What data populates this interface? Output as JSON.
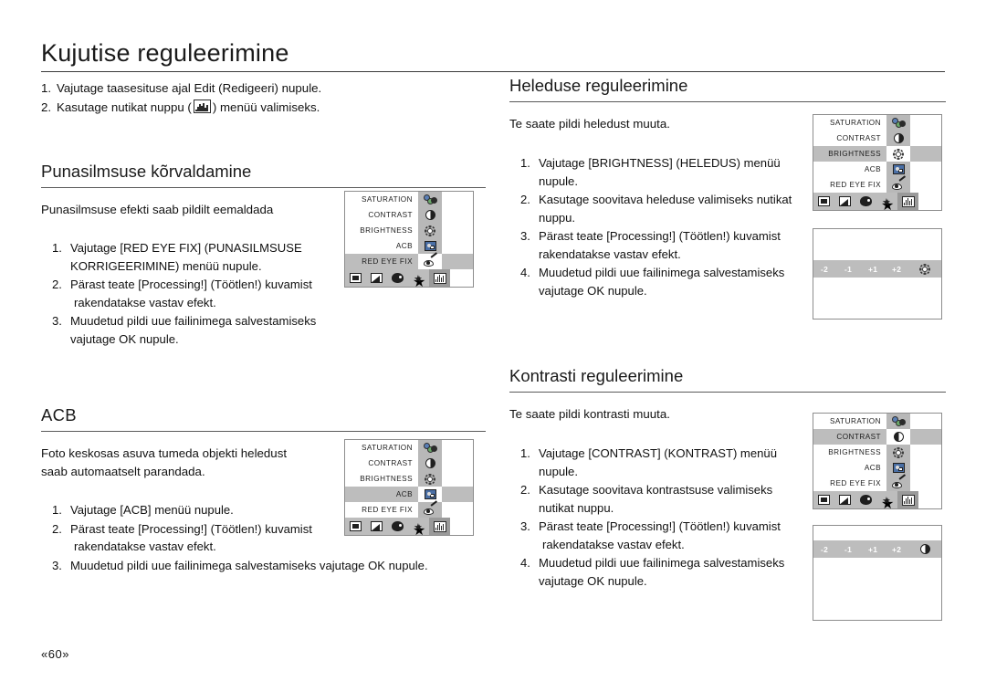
{
  "page": {
    "title": "Kujutise reguleerimine",
    "number": "«60»"
  },
  "intro": {
    "steps": [
      {
        "num": "1.",
        "pre": "Vajutage taasesituse ajal Edit (Redigeeri) nupule.",
        "post": ""
      },
      {
        "num": "2.",
        "pre": "Kasutage nutikat nuppu (",
        "post": ") menüü valimiseks.",
        "icon": "histogram-icon"
      }
    ]
  },
  "sections": {
    "red_eye": {
      "heading": "Punasilmsuse kõrvaldamine",
      "lead": "Punasilmsuse efekti saab pildilt eemaldada",
      "steps": [
        {
          "num": "1.",
          "lines": [
            "Vajutage [RED EYE FIX] (PUNASILMSUSE",
            "KORRIGEERIMINE) menüü nupule."
          ]
        },
        {
          "num": "2.",
          "lines": [
            "Pärast teate [Processing!] (Töötlen!) kuvamist",
            "rakendatakse vastav efekt."
          ]
        },
        {
          "num": "3.",
          "lines": [
            "Muudetud pildi uue failinimega salvestamiseks",
            "vajutage OK nupule."
          ]
        }
      ]
    },
    "acb": {
      "heading": "ACB",
      "lead_lines": [
        "Foto keskosas asuva tumeda objekti heledust",
        "saab automaatselt parandada."
      ],
      "steps": [
        {
          "num": "1.",
          "lines": [
            "Vajutage [ACB] menüü nupule."
          ]
        },
        {
          "num": "2.",
          "lines": [
            "Pärast teate [Processing!] (Töötlen!) kuvamist",
            "rakendatakse vastav efekt."
          ]
        },
        {
          "num": "3.",
          "lines": [
            "Muudetud pildi uue failinimega salvestamiseks vajutage OK nupule."
          ]
        }
      ]
    },
    "brightness": {
      "heading": "Heleduse reguleerimine",
      "lead": "Te saate pildi heledust muuta.",
      "steps": [
        {
          "num": "1.",
          "lines": [
            "Vajutage [BRIGHTNESS] (HELEDUS) menüü",
            "nupule."
          ]
        },
        {
          "num": "2.",
          "lines": [
            "Kasutage soovitava heleduse valimiseks nutikat",
            "nuppu."
          ]
        },
        {
          "num": "3.",
          "lines": [
            "Pärast teate [Processing!] (Töötlen!) kuvamist",
            "rakendatakse vastav efekt."
          ]
        },
        {
          "num": "4.",
          "lines": [
            "Muudetud pildi uue failinimega salvestamiseks",
            "vajutage OK nupule."
          ]
        }
      ]
    },
    "contrast": {
      "heading": "Kontrasti reguleerimine",
      "lead": "Te saate pildi kontrasti muuta.",
      "steps": [
        {
          "num": "1.",
          "lines": [
            "Vajutage [CONTRAST] (KONTRAST) menüü",
            "nupule."
          ]
        },
        {
          "num": "2.",
          "lines": [
            "Kasutage soovitava kontrastsuse valimiseks",
            "nutikat nuppu."
          ]
        },
        {
          "num": "3.",
          "lines": [
            "Pärast teate [Processing!] (Töötlen!) kuvamist",
            "rakendatakse vastav efekt."
          ]
        },
        {
          "num": "4.",
          "lines": [
            "Muudetud pildi uue failinimega salvestamiseks",
            "vajutage OK nupule."
          ]
        }
      ]
    }
  },
  "osd": {
    "menu_items": [
      "SATURATION",
      "CONTRAST",
      "BRIGHTNESS",
      "ACB",
      "RED EYE FIX"
    ],
    "tab_icons": [
      "image-icon",
      "resize-icon",
      "palette-icon",
      "star-effect-icon",
      "histogram-icon"
    ],
    "active_tab": "histogram-icon",
    "value_strip": [
      "-2",
      "-1",
      "+1",
      "+2"
    ],
    "panels": {
      "red_eye": {
        "selected": "RED EYE FIX"
      },
      "acb": {
        "selected": "ACB"
      },
      "brightness": {
        "selected": "BRIGHTNESS",
        "strip_icon": "brightness-icon"
      },
      "contrast": {
        "selected": "CONTRAST",
        "strip_icon": "contrast-icon"
      }
    }
  },
  "colors": {
    "osd_gray": "#bdbdbd",
    "osd_icon_col": "#b8b8b8",
    "tab_active": "#9a9a9a",
    "rule": "#5a5a5a"
  }
}
